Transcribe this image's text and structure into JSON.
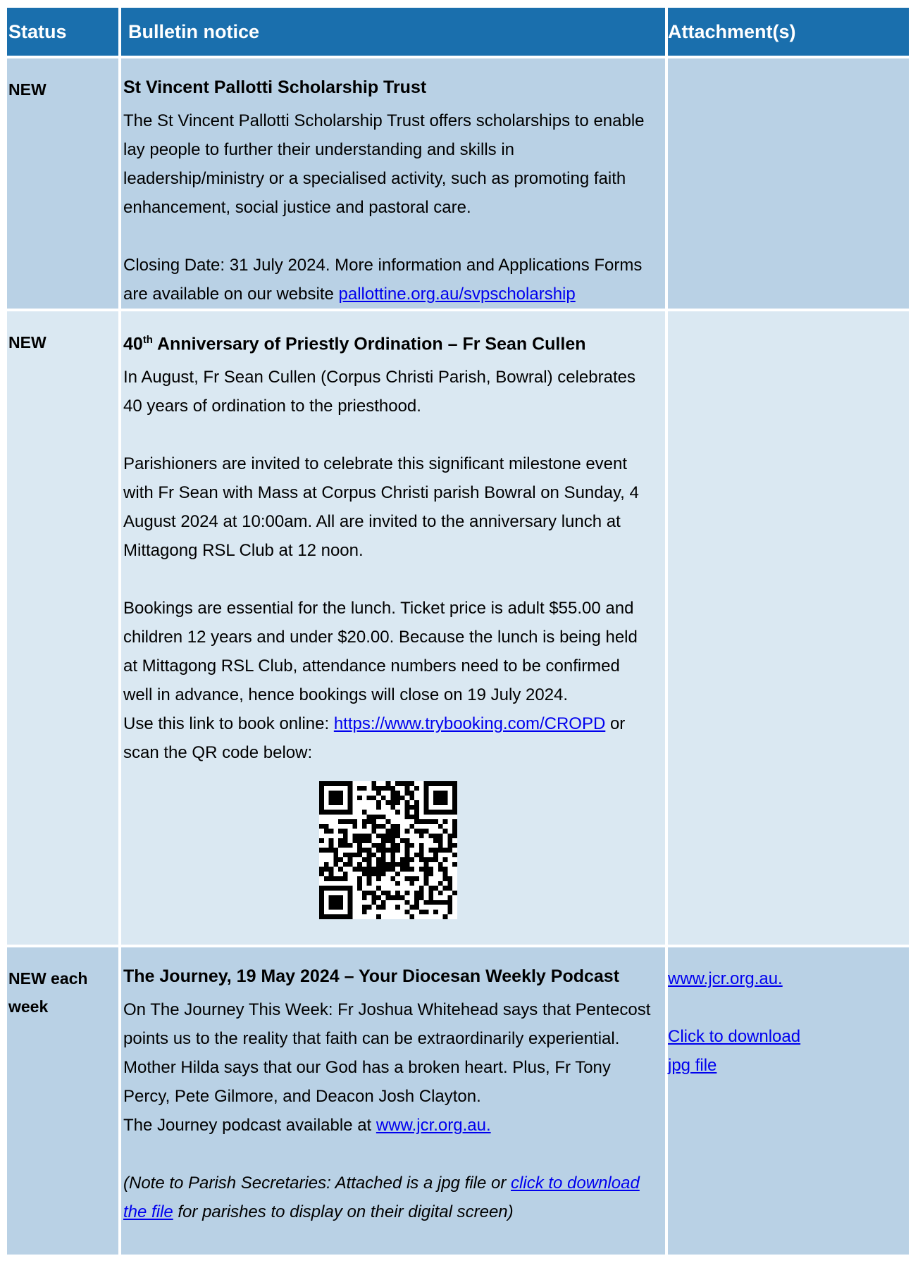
{
  "header": {
    "status": "Status",
    "notice": "Bulletin notice",
    "attachments": "Attachment(s)"
  },
  "row1": {
    "status": "NEW",
    "title": "St Vincent Pallotti Scholarship Trust",
    "para1": "The St Vincent Pallotti Scholarship Trust offers scholarships to enable lay people to further their understanding and skills in leadership/ministry or a specialised activity, such as promoting faith enhancement, social justice and pastoral care.",
    "para2_text": "Closing Date: 31 July 2024. More information and Applications Forms are available on our website ",
    "para2_link": "pallottine.org.au/svpscholarship"
  },
  "row2": {
    "status": "NEW",
    "title_num": "40",
    "title_sup": "th",
    "title_rest": " Anniversary of Priestly Ordination – Fr Sean Cullen",
    "para1": "In August, Fr Sean Cullen (Corpus Christi Parish, Bowral) celebrates 40 years of ordination to the priesthood.",
    "para2": "Parishioners are invited to celebrate this significant milestone event with Fr Sean with Mass at Corpus Christi parish Bowral on Sunday, 4 August 2024 at 10:00am. All are invited to the anniversary lunch at Mittagong RSL Club at 12 noon.",
    "para3": "Bookings are essential for the lunch. Ticket price is adult $55.00 and children 12 years and under $20.00. Because the lunch is being held at Mittagong RSL Club, attendance numbers need to be confirmed well in advance, hence bookings will close on 19 July 2024.",
    "para4_text": "Use this link to book online: ",
    "para4_link": "https://www.trybooking.com/CROPD",
    "para4_after": "  or scan the QR code below:"
  },
  "row3": {
    "status": "NEW each week",
    "title": "The Journey, 19 May 2024 – Your Diocesan Weekly Podcast",
    "para1": "On The Journey This Week: Fr Joshua Whitehead says that Pentecost points us to the reality that faith can be extraordinarily experiential. Mother Hilda says that our God has a broken heart. Plus, Fr Tony Percy, Pete Gilmore, and Deacon Josh Clayton.",
    "para2_text": "The Journey podcast available at ",
    "para2_link": "www.jcr.org.au.",
    "note_before": "(Note to Parish Secretaries: Attached is a jpg file or ",
    "note_link": "click to download the file",
    "note_after": " for parishes to display on their digital screen)",
    "attach_link1": "www.jcr.org.au.",
    "attach_link2": "Click to download jpg file"
  },
  "colors": {
    "header_bg": "#1a6fad",
    "row_dark": "#b9d1e5",
    "row_light": "#dae8f2",
    "link": "#0000ee"
  }
}
